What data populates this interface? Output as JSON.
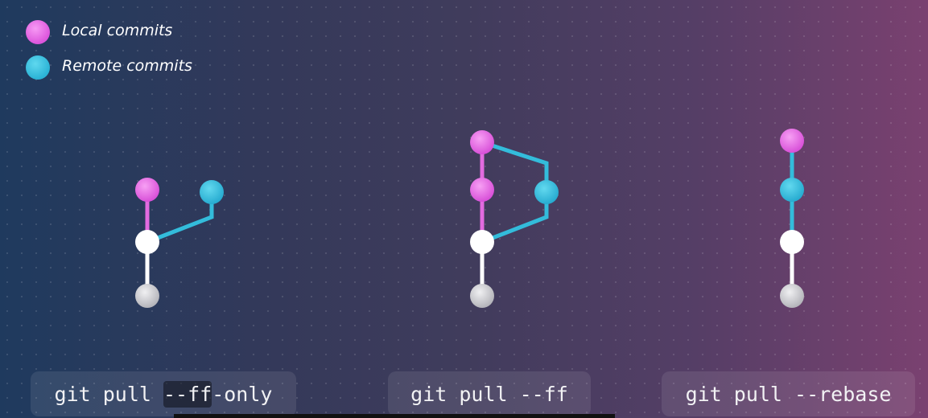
{
  "legend": {
    "local_label": "Local commits",
    "remote_label": "Remote commits"
  },
  "colors": {
    "local": "#e26be0",
    "remote": "#33bcdb",
    "base": "#ffffff",
    "older": "#c8c8cc"
  },
  "commands": [
    {
      "prefix": "git pull ",
      "highlight": "--ff",
      "suffix": "-only"
    },
    {
      "prefix": "git pull --ff",
      "highlight": "",
      "suffix": ""
    },
    {
      "prefix": "git pull --rebase",
      "highlight": "",
      "suffix": ""
    }
  ]
}
